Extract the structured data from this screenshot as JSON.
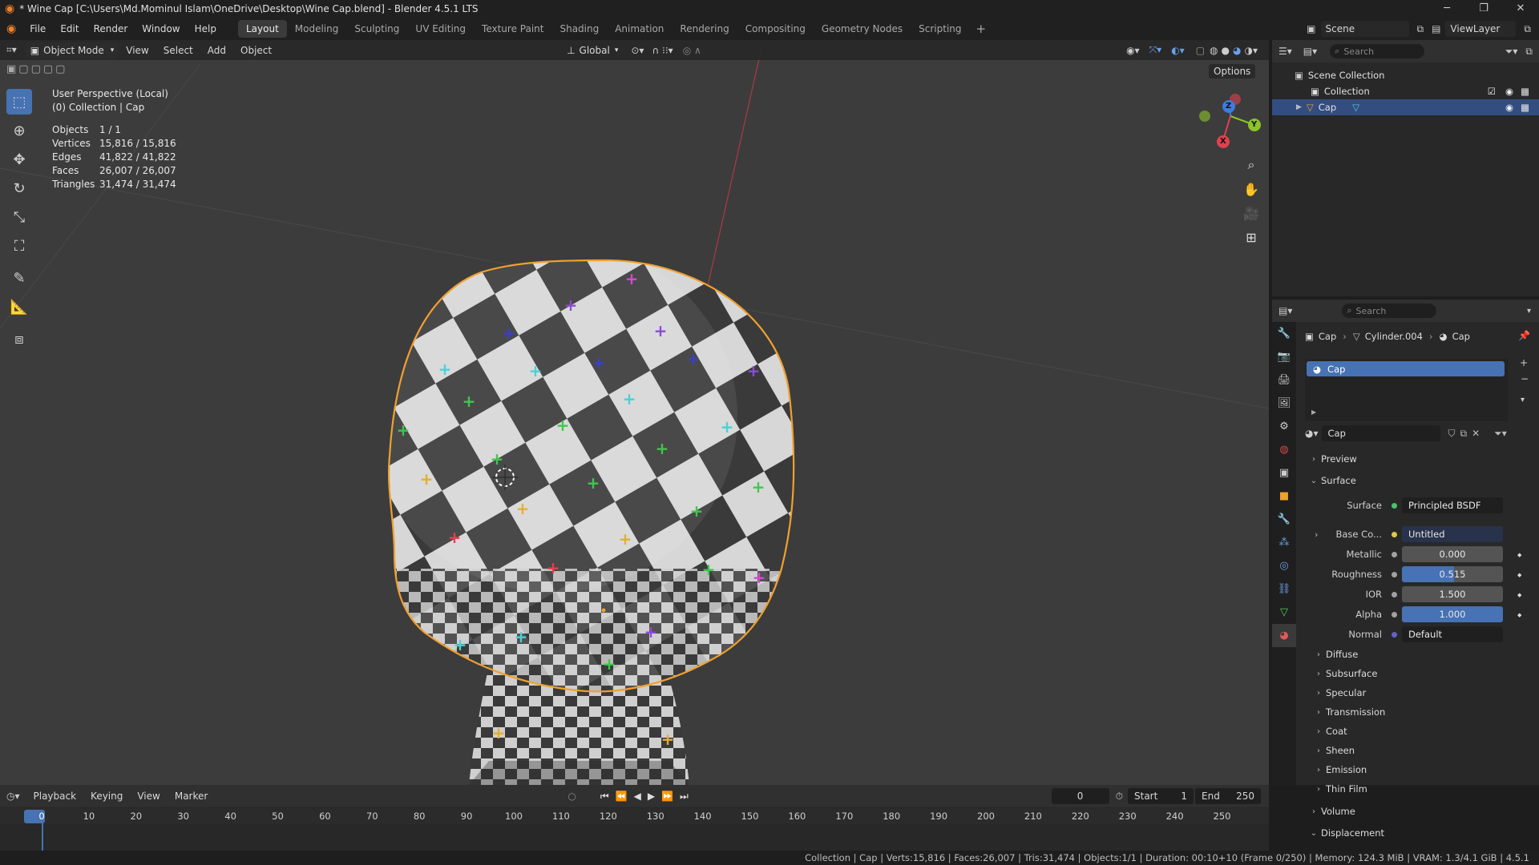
{
  "titlebar": {
    "title": "* Wine Cap [C:\\Users\\Md.Mominul Islam\\OneDrive\\Desktop\\Wine Cap.blend] - Blender 4.5.1 LTS",
    "min": "─",
    "max": "❐",
    "close": "✕"
  },
  "menu": [
    "File",
    "Edit",
    "Render",
    "Window",
    "Help"
  ],
  "workspaces": [
    "Layout",
    "Modeling",
    "Sculpting",
    "UV Editing",
    "Texture Paint",
    "Shading",
    "Animation",
    "Rendering",
    "Compositing",
    "Geometry Nodes",
    "Scripting"
  ],
  "active_workspace": "Layout",
  "scene": {
    "label": "Scene",
    "viewlayer": "ViewLayer"
  },
  "viewport_header": {
    "mode": "Object Mode",
    "menus": [
      "View",
      "Select",
      "Add",
      "Object"
    ],
    "orientation": "Global",
    "options": "Options"
  },
  "overlay_text": {
    "perspective": "User Perspective (Local)",
    "collection": "(0) Collection | Cap"
  },
  "stats": [
    {
      "k": "Objects",
      "v": "1 / 1"
    },
    {
      "k": "Vertices",
      "v": "15,816 / 15,816"
    },
    {
      "k": "Edges",
      "v": "41,822 / 41,822"
    },
    {
      "k": "Faces",
      "v": "26,007 / 26,007"
    },
    {
      "k": "Triangles",
      "v": "31,474 / 31,474"
    }
  ],
  "gizmo": {
    "x": "X",
    "y": "Y",
    "z": "Z"
  },
  "outliner": {
    "search": "Search",
    "scene_collection": "Scene Collection",
    "collection": "Collection",
    "object": "Cap"
  },
  "properties": {
    "search": "Search",
    "breadcrumb": [
      "Cap",
      "Cylinder.004",
      "Cap"
    ],
    "slot": "Cap",
    "material_name": "Cap",
    "preview": "Preview",
    "surface_section": "Surface",
    "rows": [
      {
        "label": "Surface",
        "value": "Principled BSDF",
        "style": "dark",
        "dot": "#4bc26c"
      },
      {
        "label": "Base Co...",
        "value": "Untitled",
        "style": "dark",
        "dot": "#e2c844"
      },
      {
        "label": "Metallic",
        "value": "0.000",
        "style": "grey",
        "dot": "#a1a1a1"
      },
      {
        "label": "Roughness",
        "value": "0.515",
        "style": "partial",
        "dot": "#a1a1a1"
      },
      {
        "label": "IOR",
        "value": "1.500",
        "style": "grey",
        "dot": "#a1a1a1"
      },
      {
        "label": "Alpha",
        "value": "1.000",
        "style": "blue",
        "dot": "#a1a1a1"
      },
      {
        "label": "Normal",
        "value": "Default",
        "style": "dark",
        "dot": "#6363c7"
      }
    ],
    "roughness_fraction": 0.515,
    "subsections": [
      "Diffuse",
      "Subsurface",
      "Specular",
      "Transmission",
      "Coat",
      "Sheen",
      "Emission",
      "Thin Film"
    ],
    "bottom_sections": [
      "Volume",
      "Displacement"
    ]
  },
  "timeline": {
    "menus": [
      "Playback",
      "Keying",
      "View",
      "Marker"
    ],
    "current": "0",
    "start_label": "Start",
    "start": "1",
    "end_label": "End",
    "end": "250",
    "ticks": [
      "0",
      "10",
      "20",
      "30",
      "40",
      "50",
      "60",
      "70",
      "80",
      "90",
      "100",
      "110",
      "120",
      "130",
      "140",
      "150",
      "160",
      "170",
      "180",
      "190",
      "200",
      "210",
      "220",
      "230",
      "240",
      "250"
    ]
  },
  "status": "Collection | Cap | Verts:15,816 | Faces:26,007 | Tris:31,474 | Objects:1/1 | Duration: 00:10+10 (Frame 0/250) | Memory: 124.3 MiB | VRAM: 1.3/4.1 GiB | 4.5.1",
  "colors": {
    "accent": "#4772b3",
    "selection": "#f0a030",
    "x_axis": "#e0404f",
    "y_axis": "#8cc32a",
    "z_axis": "#3e7bdb"
  }
}
